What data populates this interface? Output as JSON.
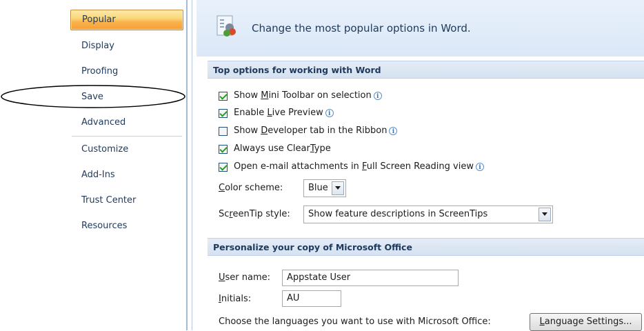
{
  "nav": {
    "items": [
      {
        "label": "Popular",
        "selected": true
      },
      {
        "label": "Display"
      },
      {
        "label": "Proofing"
      },
      {
        "label": "Save"
      },
      {
        "label": "Advanced"
      },
      {
        "label": "Customize"
      },
      {
        "label": "Add-Ins"
      },
      {
        "label": "Trust Center"
      },
      {
        "label": "Resources"
      }
    ]
  },
  "header": {
    "title": "Change the most popular options in Word."
  },
  "top_options": {
    "heading": "Top options for working with Word",
    "checkboxes": [
      {
        "pre": "Show ",
        "key": "M",
        "post": "ini Toolbar on selection",
        "checked": true
      },
      {
        "pre": "Enable ",
        "key": "L",
        "post": "ive Preview",
        "checked": true
      },
      {
        "pre": "Show ",
        "key": "D",
        "post": "eveloper tab in the Ribbon",
        "checked": false
      },
      {
        "pre": "Always use Clear",
        "key": "T",
        "post": "ype",
        "checked": true
      },
      {
        "pre": "Open e-mail attachments in ",
        "key": "F",
        "post": "ull Screen Reading view",
        "checked": true
      }
    ],
    "color_scheme": {
      "pre": "",
      "key": "C",
      "post": "olor scheme:",
      "value": "Blue"
    },
    "screentip": {
      "pre": "Sc",
      "key": "r",
      "post": "eenTip style:",
      "value": "Show feature descriptions in ScreenTips"
    }
  },
  "personalize": {
    "heading": "Personalize your copy of Microsoft Office",
    "user_name": {
      "pre": "",
      "key": "U",
      "post": "ser name:",
      "value": "Appstate User"
    },
    "initials": {
      "pre": "",
      "key": "I",
      "post": "nitials:",
      "value": "AU"
    },
    "languages_text": "Choose the languages you want to use with Microsoft Office:",
    "language_button": {
      "pre": "",
      "key": "L",
      "post": "anguage Settings..."
    }
  },
  "colors": {
    "accent": "#f9b24d",
    "nav_text": "#1e395b",
    "check_green": "#21a121"
  }
}
